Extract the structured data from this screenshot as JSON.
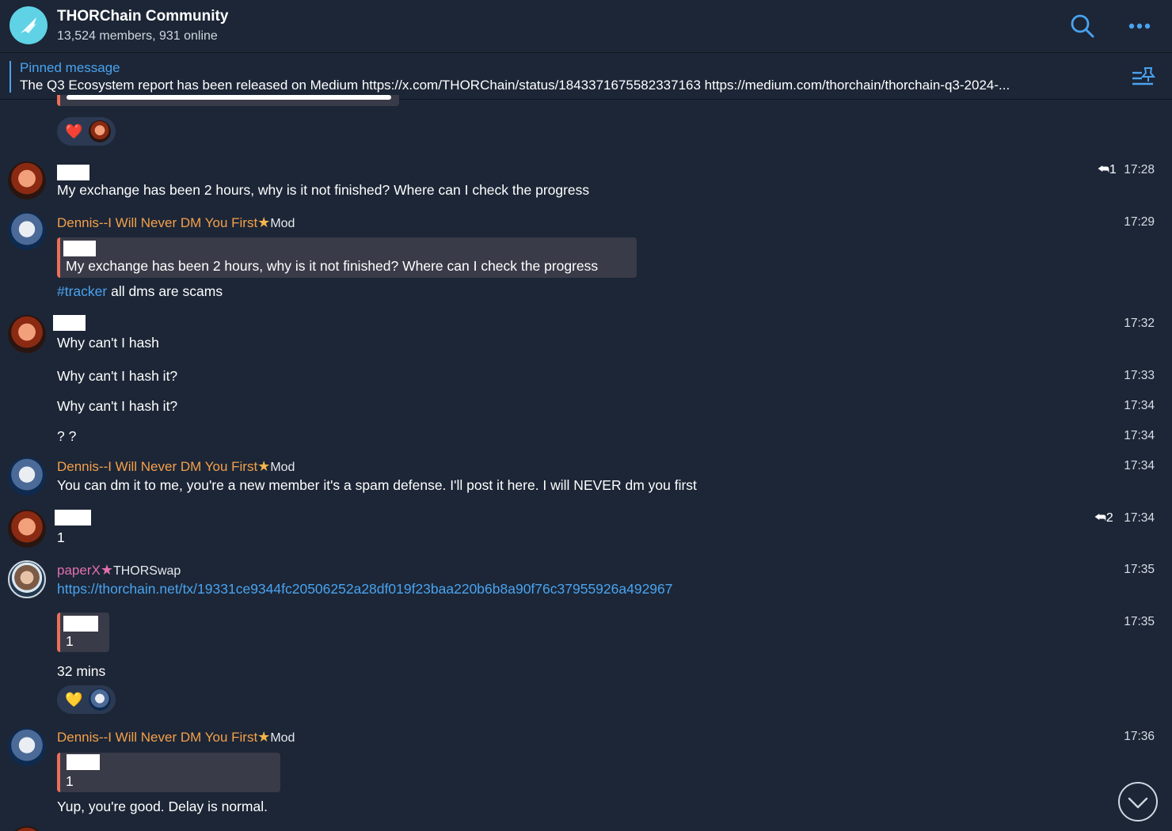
{
  "header": {
    "title": "THORChain Community",
    "subtitle": "13,524 members, 931 online"
  },
  "pinned": {
    "label": "Pinned message",
    "text": "The Q3 Ecosystem report has been released on Medium  https://x.com/THORChain/status/1843371675582337163 https://medium.com/thorchain/thorchain-q3-2024-..."
  },
  "messages": {
    "m1": {
      "text": "My exchange has been 2 hours, why is it not finished? Where can I check the progress",
      "reply_count": "1",
      "time": "17:28"
    },
    "m2": {
      "name": "Dennis--I Will Never DM You First",
      "role": "Mod",
      "quote": "My exchange has been 2 hours, why is it not finished? Where can I check the progress",
      "hashtag": "#tracker",
      "text": " all dms are scams",
      "time": "17:29"
    },
    "m3": {
      "text": "Why can't I hash",
      "time": "17:32"
    },
    "m4": {
      "text": "Why can't I hash it?",
      "time": "17:33"
    },
    "m5": {
      "text": "Why can't I hash it?",
      "time": "17:34"
    },
    "m6": {
      "text": "? ?",
      "time": "17:34"
    },
    "m7": {
      "name": "Dennis--I Will Never DM You First",
      "role": "Mod",
      "text": "You can dm it to me, you're a new member it's a spam defense. I'll post it here. I will NEVER dm you first",
      "time": "17:34"
    },
    "m8": {
      "text": "1",
      "reply_count": "2",
      "time": "17:34"
    },
    "m9": {
      "name": "paperX",
      "role": "THORSwap",
      "link": "https://thorchain.net/tx/19331ce9344fc20506252a28df019f23baa220b6b8a90f76c37955926a492967",
      "time": "17:35"
    },
    "m10": {
      "quote": "1",
      "text": "32 mins",
      "time": "17:35"
    },
    "m11": {
      "name": "Dennis--I Will Never DM You First",
      "role": "Mod",
      "quote": "1",
      "text": "Yup, you're good. Delay is normal.",
      "time": "17:36"
    }
  },
  "reactions": {
    "r1": "❤️",
    "r2": "💛"
  },
  "colors": {
    "background": "#1c2636",
    "accent": "#4aa3f0",
    "mod_name": "#f5a04a",
    "paperx_name": "#e46fb0",
    "quote_border": "#ec6f5a"
  }
}
